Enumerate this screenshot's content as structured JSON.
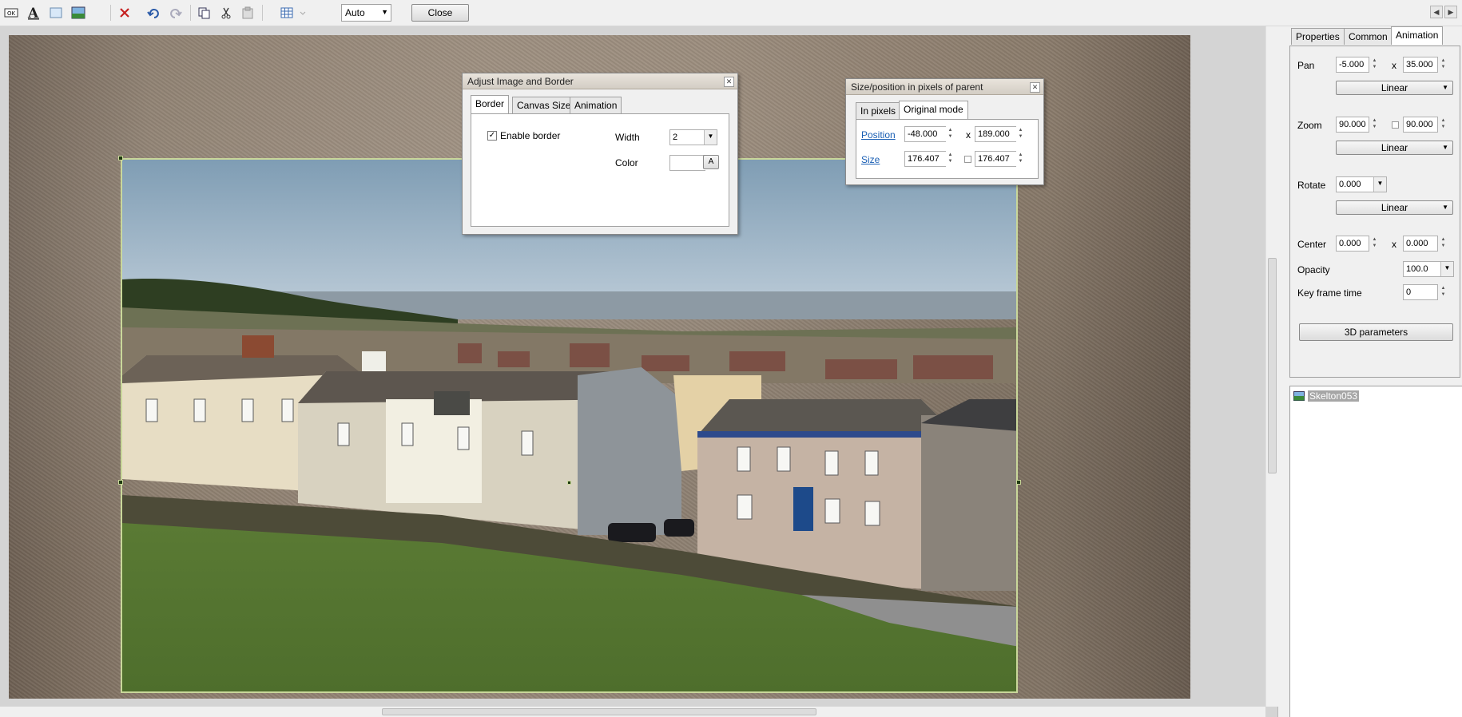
{
  "toolbar": {
    "icons": [
      "ok-icon",
      "text-icon",
      "rectangle-icon",
      "image-icon",
      "delete-icon",
      "undo-icon",
      "redo-icon",
      "copy-icon",
      "cut-icon",
      "paste-icon",
      "grid-icon",
      "grid-dropdown-icon"
    ],
    "zoom_value": "Auto",
    "close_label": "Close"
  },
  "adjust_dialog": {
    "title": "Adjust Image and Border",
    "tabs": [
      "Border",
      "Canvas Size",
      "Animation"
    ],
    "enable_border_label": "Enable border",
    "enable_border_checked": true,
    "width_label": "Width",
    "width_value": "2",
    "color_label": "Color",
    "color_button": "A"
  },
  "size_dialog": {
    "title": "Size/position in pixels of parent",
    "tabs": [
      "In pixels",
      "Original mode"
    ],
    "position_label": "Position",
    "position_x": "-48.000",
    "position_y": "189.000",
    "size_label": "Size",
    "size_w": "176.407",
    "size_h": "176.407",
    "sep": "x"
  },
  "right_panel": {
    "tabs": [
      "Properties",
      "Common",
      "Animation"
    ],
    "pan_label": "Pan",
    "pan_x": "-5.000",
    "pan_y": "35.000",
    "pan_mode": "Linear",
    "zoom_label": "Zoom",
    "zoom_x": "90.000",
    "zoom_y": "90.000",
    "zoom_mode": "Linear",
    "rotate_label": "Rotate",
    "rotate_value": "0.000",
    "rotate_mode": "Linear",
    "center_label": "Center",
    "center_x": "0.000",
    "center_y": "0.000",
    "opacity_label": "Opacity",
    "opacity_value": "100.0",
    "keyframe_label": "Key frame time",
    "keyframe_value": "0",
    "params_button": "3D parameters",
    "sep": "x"
  },
  "object_list": {
    "items": [
      "Skelton053"
    ]
  }
}
